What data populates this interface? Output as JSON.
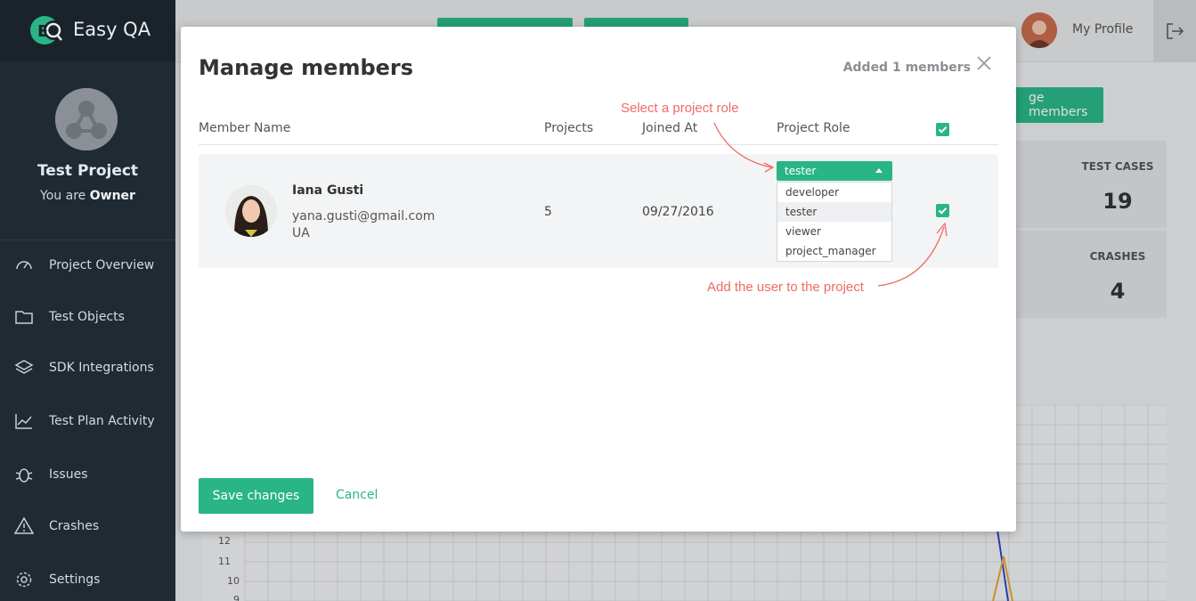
{
  "brand": {
    "name": "Easy QA"
  },
  "project": {
    "title": "Test Project",
    "role_prefix": "You are",
    "role": "Owner"
  },
  "sidebar": {
    "items": [
      {
        "label": "Project Overview",
        "icon": "dashboard-icon"
      },
      {
        "label": "Test Objects",
        "icon": "folder-icon"
      },
      {
        "label": "SDK Integrations",
        "icon": "layers-icon"
      },
      {
        "label": "Test Plan Activity",
        "icon": "activity-chart-icon"
      },
      {
        "label": "Issues",
        "icon": "bug-icon"
      },
      {
        "label": "Crashes",
        "icon": "warning-icon"
      },
      {
        "label": "Settings",
        "icon": "gear-icon"
      }
    ]
  },
  "header": {
    "profile_label": "My Profile"
  },
  "background": {
    "manage_button_label": "ge members",
    "stats": [
      {
        "title": "TEST CASES",
        "value": "19"
      },
      {
        "title": "CRASHES",
        "value": "4"
      }
    ],
    "chart_ticks": [
      "12",
      "11",
      "10",
      "9"
    ]
  },
  "modal": {
    "title": "Manage members",
    "added_label": "Added 1 members",
    "columns": {
      "member_name": "Member Name",
      "projects": "Projects",
      "joined_at": "Joined At",
      "project_role": "Project Role"
    },
    "member": {
      "name": "Iana Gusti",
      "email": "yana.gusti@gmail.com",
      "country": "UA",
      "projects": "5",
      "joined": "09/27/2016",
      "role_selected": "tester",
      "role_options": [
        "developer",
        "tester",
        "viewer",
        "project_manager"
      ],
      "included": true
    },
    "save_label": "Save changes",
    "cancel_label": "Cancel"
  },
  "annotations": {
    "select_role": "Select a project role",
    "add_user": "Add the user to the project"
  },
  "colors": {
    "accent": "#2ab587",
    "sidebar": "#1f2a32",
    "annotation": "#f06a63"
  }
}
